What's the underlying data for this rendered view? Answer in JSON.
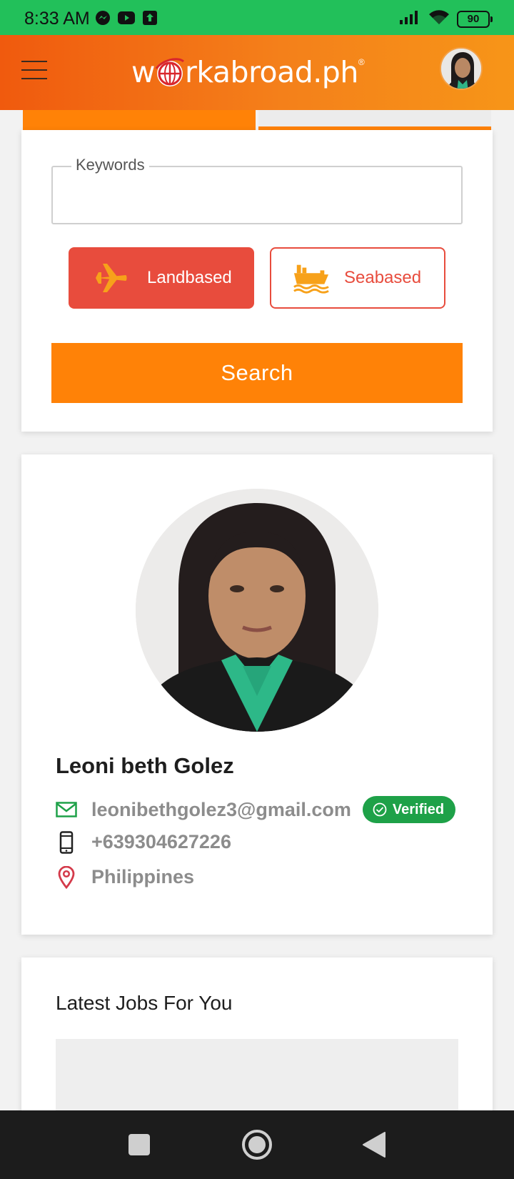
{
  "status_bar": {
    "time": "8:33 AM",
    "battery": "90",
    "apps": [
      "messenger-icon",
      "youtube-icon",
      "upload-icon"
    ],
    "indicators": [
      "signal-icon",
      "wifi-icon",
      "battery-icon"
    ]
  },
  "header": {
    "logo_pre": "w",
    "logo_post": "rkabroad.ph",
    "logo_mark": "®",
    "menu_icon": "hamburger-icon",
    "avatar": "user-avatar"
  },
  "search": {
    "keywords_label": "Keywords",
    "keywords_value": "",
    "landbased_label": "Landbased",
    "landbased_icon": "airplane-icon",
    "seabased_label": "Seabased",
    "seabased_icon": "ship-icon",
    "search_label": "Search"
  },
  "profile": {
    "name": "Leoni beth Golez",
    "email": "leonibethgolez3@gmail.com",
    "verified": "Verified",
    "phone": "+639304627226",
    "location": "Philippines"
  },
  "jobs": {
    "title": "Latest Jobs For You"
  },
  "colors": {
    "status_bar": "#22c05a",
    "header_start": "#f05a0e",
    "header_end": "#f79518",
    "accent": "#ff8207",
    "red": "#e84c3d",
    "verified": "#1ea148"
  },
  "nav_bar": [
    "recents-icon",
    "home-icon",
    "back-icon"
  ]
}
